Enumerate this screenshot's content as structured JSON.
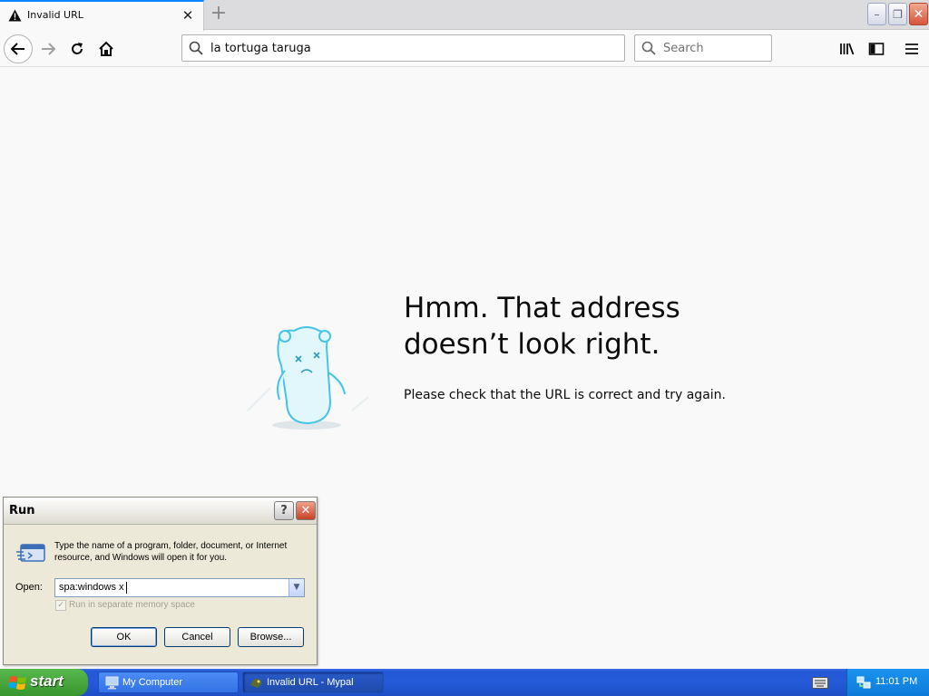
{
  "browser": {
    "tab_title": "Invalid URL",
    "url_value": "la tortuga taruga",
    "search_placeholder": "Search"
  },
  "error_page": {
    "title_line1": "Hmm. That address",
    "title_line2": "doesn’t look right.",
    "description": "Please check that the URL is correct and try again."
  },
  "run_dialog": {
    "title": "Run",
    "help_label": "?",
    "description": "Type the name of a program, folder, document, or Internet resource, and Windows will open it for you.",
    "open_label": "Open:",
    "input_value": "spa:windows x",
    "checkbox_label": "Run in separate memory space",
    "checkbox_checked": true,
    "checkbox_enabled": false,
    "ok_label": "OK",
    "cancel_label": "Cancel",
    "browse_label": "Browse..."
  },
  "taskbar": {
    "start_label": "start",
    "tasks": [
      {
        "label": "My Computer",
        "icon": "my-computer-icon"
      },
      {
        "label": "Invalid URL - Mypal",
        "icon": "mypal-icon"
      }
    ],
    "clock": "11:01 PM"
  },
  "colors": {
    "accent": "#0a84ff",
    "xp_taskbar": "#245ad8",
    "xp_start": "#37962d",
    "page_bg": "#f9f9fa"
  }
}
